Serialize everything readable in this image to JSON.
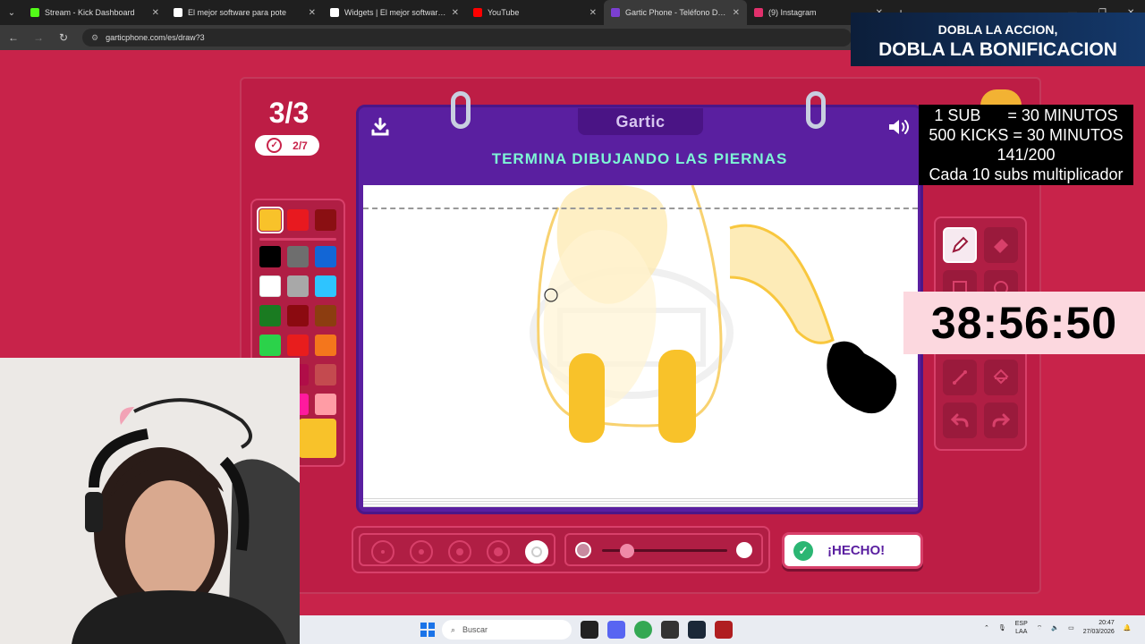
{
  "browser": {
    "tabs": [
      {
        "title": "Stream - Kick Dashboard",
        "icon_color": "#53fc18",
        "active": false
      },
      {
        "title": "El mejor software para pote",
        "icon_color": "#ffffff",
        "active": false
      },
      {
        "title": "Widgets | El mejor software pa",
        "icon_color": "#ffffff",
        "active": false
      },
      {
        "title": "YouTube",
        "icon_color": "#ff0000",
        "active": false
      },
      {
        "title": "Gartic Phone - Teléfono Descon",
        "icon_color": "#7b3fd1",
        "active": true
      },
      {
        "title": "(9) Instagram",
        "icon_color": "#e1306c",
        "active": false
      }
    ],
    "new_tab": "+",
    "url": "garticphone.com/es/draw?3",
    "back": "←",
    "forward": "→",
    "reload": "↻",
    "window_controls": [
      "—",
      "❐",
      "✕"
    ]
  },
  "game": {
    "round": "3/3",
    "players_done": "2/7",
    "logo": "Gartic",
    "instruction": "TERMINA DIBUJANDO LAS PIERNAS",
    "done_button": "¡HECHO!",
    "palette": [
      "#f8c22a",
      "#e8191f",
      "#8a0f12",
      "#000000",
      "#6e6e6e",
      "#1266d6",
      "#ffffff",
      "#a8a8a8",
      "#2ec4ff",
      "#1a7b21",
      "#8b0a10",
      "#8c3d10",
      "#2bd24a",
      "#e81d1d",
      "#f4761c",
      "#b00d48",
      "#c44a4f",
      "#ff1a9e",
      "#ff9ca5"
    ],
    "selected_color": "#f8c22a",
    "brush_sizes": [
      1,
      2,
      3,
      4,
      5
    ],
    "selected_brush_size": 5,
    "opacity_level": 0.2,
    "canvas_watermark": "Gartic PHONE"
  },
  "overlay": {
    "banner_line1": "DOBLA LA ACCION,",
    "banner_line2": "DOBLA LA BONIFICACION",
    "sub_lines": [
      "1 SUB      = 30 MINUTOS",
      "500 KICKS = 30 MINUTOS",
      "141/200",
      "Cada 10 subs multiplicador"
    ],
    "timer": "38:56:50"
  },
  "taskbar": {
    "search_placeholder": "Buscar",
    "language_line1": "ESP",
    "language_line2": "LAA",
    "time": "20:47",
    "date": "27/03/2026",
    "app_colors": [
      "#222222",
      "#5865f2",
      "#34a853",
      "#333333",
      "#1b2838",
      "#b01e20"
    ]
  }
}
